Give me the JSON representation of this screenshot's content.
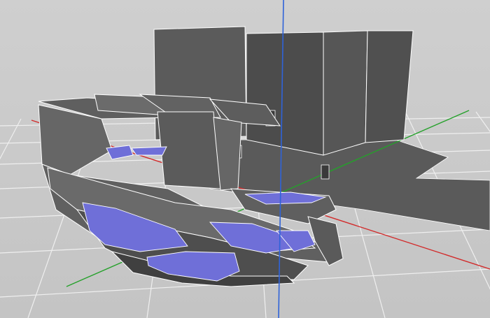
{
  "viewport": {
    "colors": {
      "background": "#c9c9c9",
      "grid": "#efefef",
      "axis_x": "#d22a2a",
      "axis_y": "#24a12a",
      "axis_z": "#2f63d9",
      "building": "#5a5a5a",
      "building_dark": "#4a4a4a",
      "seating": "#6f6fd8",
      "edge": "#ffffff"
    }
  }
}
